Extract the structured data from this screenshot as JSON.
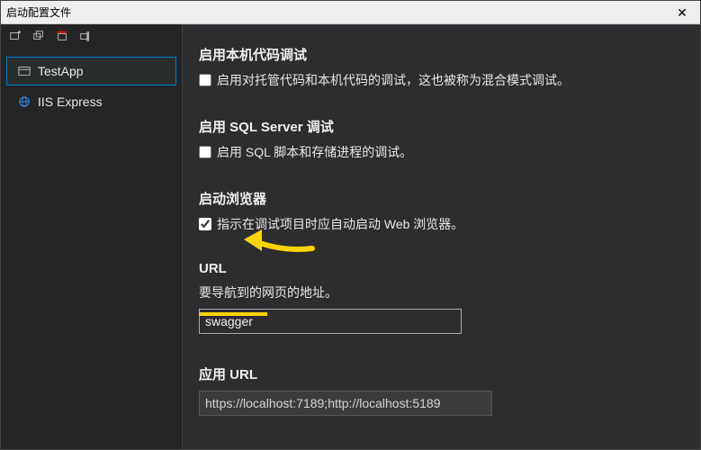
{
  "window": {
    "title": "启动配置文件"
  },
  "sidebar": {
    "profiles": [
      {
        "label": "TestApp",
        "icon": "window",
        "selected": true
      },
      {
        "label": "IIS Express",
        "icon": "globe",
        "selected": false
      }
    ]
  },
  "sections": {
    "native": {
      "heading": "启用本机代码调试",
      "checkbox_label": "启用对托管代码和本机代码的调试，这也被称为混合模式调试。",
      "checked": false
    },
    "sql": {
      "heading": "启用 SQL Server 调试",
      "checkbox_label": "启用 SQL 脚本和存储进程的调试。",
      "checked": false
    },
    "browser": {
      "heading": "启动浏览器",
      "checkbox_label": "指示在调试项目时应自动启动 Web 浏览器。",
      "checked": true
    },
    "url": {
      "heading": "URL",
      "desc": "要导航到的网页的地址。",
      "value": "swagger"
    },
    "appurl": {
      "heading": "应用 URL",
      "value": "https://localhost:7189;http://localhost:5189"
    }
  }
}
